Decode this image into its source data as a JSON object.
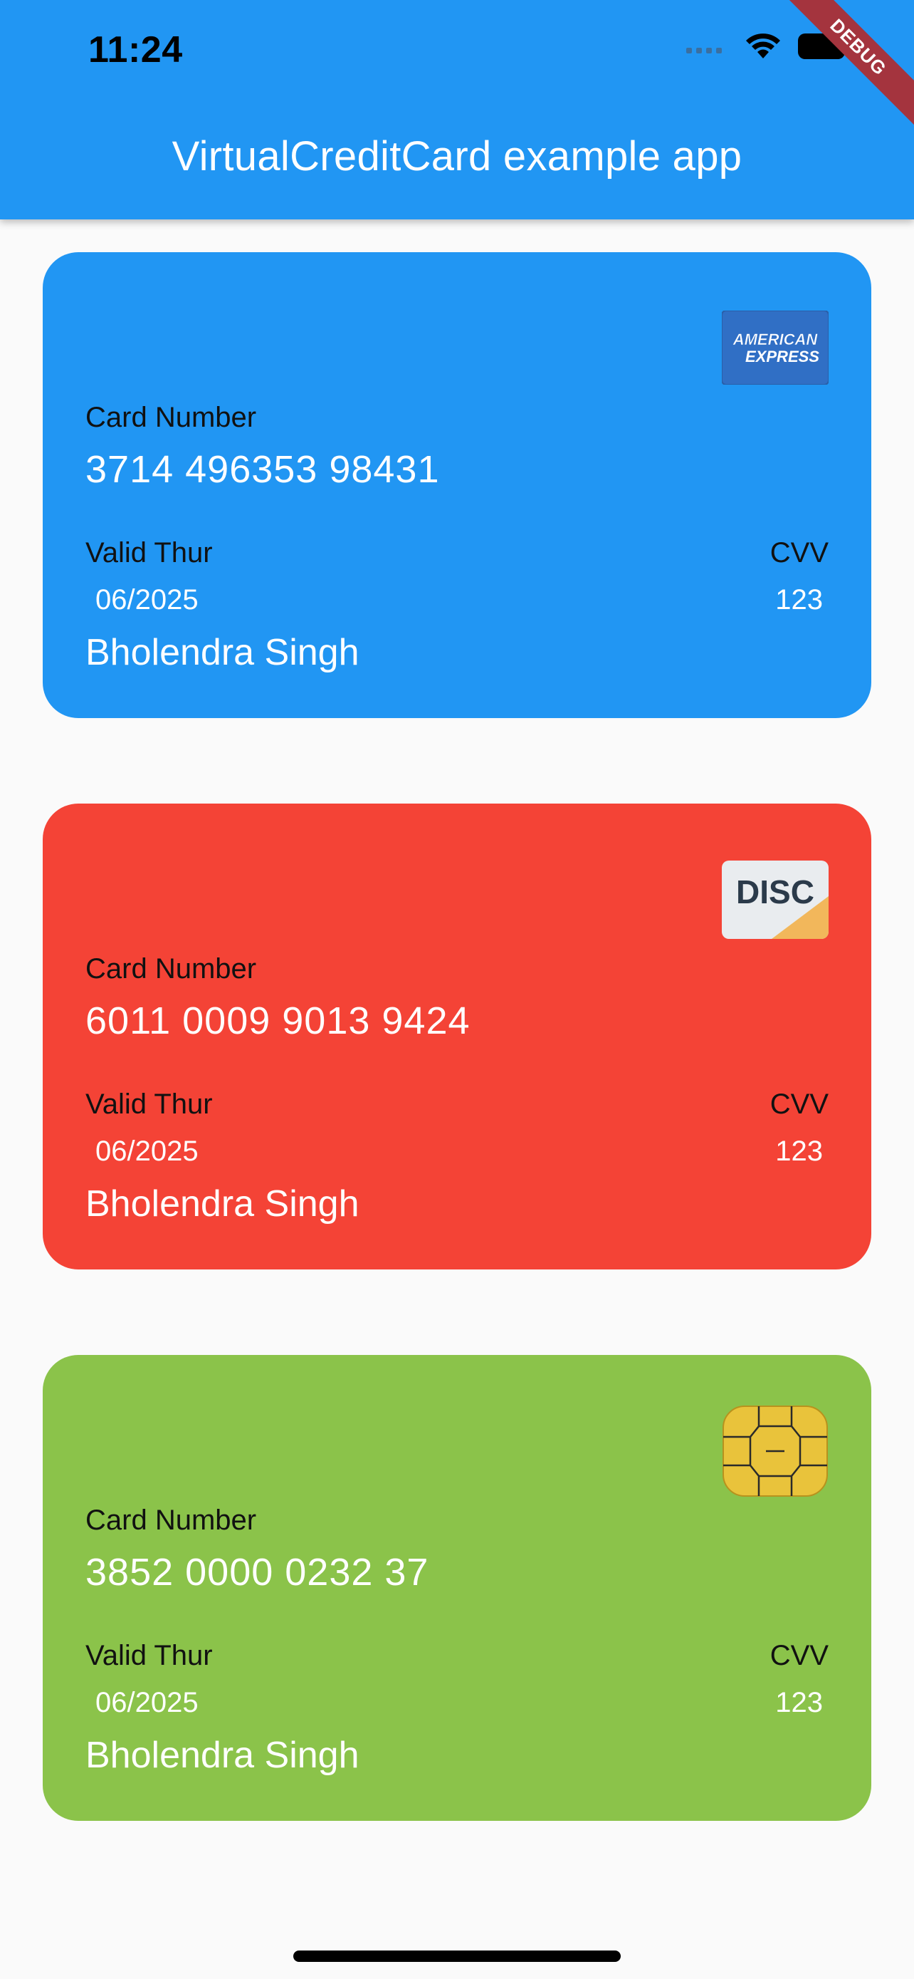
{
  "status_bar": {
    "time": "11:24"
  },
  "app_bar": {
    "title": "VirtualCreditCard example app"
  },
  "debug_banner": "DEBUG",
  "cards": [
    {
      "brand": "AMERICAN EXPRESS",
      "brand_lines": [
        "AMERICAN",
        "EXPRESS"
      ],
      "color": "#2196f3",
      "number_label": "Card Number",
      "number": "3714 496353 98431",
      "valid_label": "Valid Thur",
      "valid": "06/2025",
      "cvv_label": "CVV",
      "cvv": "123",
      "holder": "Bholendra Singh"
    },
    {
      "brand": "DISC",
      "color": "#f44336",
      "number_label": "Card Number",
      "number": "6011 0009 9013 9424",
      "valid_label": "Valid Thur",
      "valid": "06/2025",
      "cvv_label": "CVV",
      "cvv": "123",
      "holder": "Bholendra Singh"
    },
    {
      "brand": "chip",
      "color": "#8bc34a",
      "number_label": "Card Number",
      "number": "3852 0000 0232 37",
      "valid_label": "Valid Thur",
      "valid": "06/2025",
      "cvv_label": "CVV",
      "cvv": "123",
      "holder": "Bholendra Singh"
    }
  ],
  "icons": {
    "signal": "cellular-signal-icon",
    "wifi": "wifi-icon",
    "battery": "battery-icon"
  }
}
